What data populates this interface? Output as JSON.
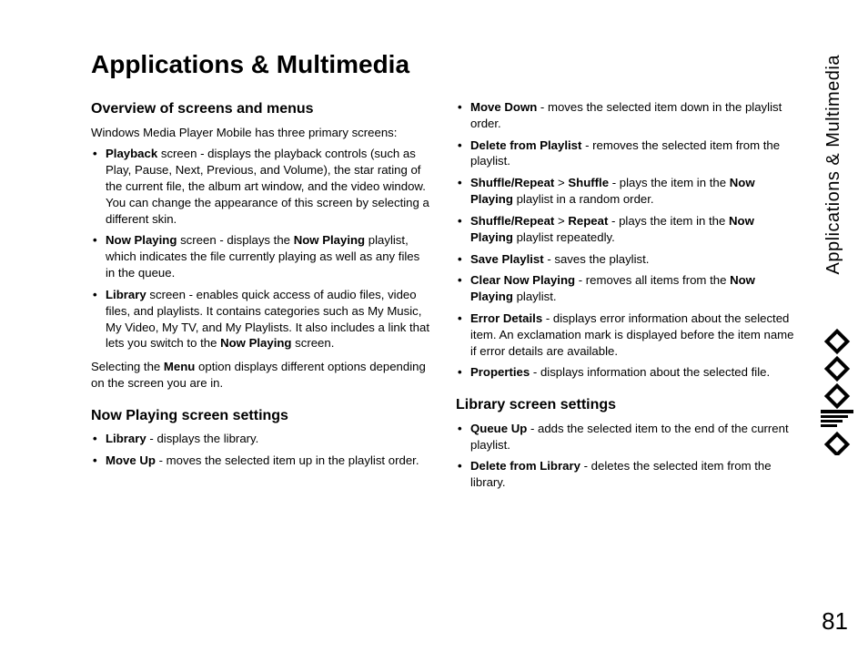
{
  "title": "Applications & Multimedia",
  "side_label": "Applications & Multimedia",
  "page_number": "81",
  "col1": {
    "h_overview": "Overview of screens and menus",
    "p_intro": "Windows Media Player Mobile has three primary screens:",
    "b_playback_label": "Playback",
    "b_playback_text": " screen - displays the playback controls (such as Play, Pause, Next, Previous, and Volume), the star rating of the current file, the album art window, and the video window. You can change the appearance of this screen by selecting a different skin.",
    "b_nowplaying_label": "Now Playing",
    "b_nowplaying_text1": " screen - displays the ",
    "b_nowplaying_bold": "Now Playing",
    "b_nowplaying_text2": " playlist, which indicates the file currently playing as well as any files in the queue.",
    "b_library_label": "Library",
    "b_library_text1": " screen - enables quick access of audio files, video files, and playlists. It contains categories such as My Music, My Video, My TV, and My Playlists. It also includes a link that lets you switch to the ",
    "b_library_bold": "Now Playing",
    "b_library_text2": " screen.",
    "p_menu_1": "Selecting the ",
    "p_menu_bold": "Menu",
    "p_menu_2": " option displays different options depending on the screen you are in.",
    "h_nowplaying": "Now Playing screen settings",
    "np_library_label": "Library",
    "np_library_text": " - displays the library.",
    "np_moveup_label": "Move Up",
    "np_moveup_text": " - moves the selected item up in the playlist order."
  },
  "col2": {
    "np_movedown_label": "Move Down",
    "np_movedown_text": " - moves the selected item down in the playlist order.",
    "np_delete_label": "Delete from Playlist",
    "np_delete_text": " - removes the selected item from the playlist.",
    "np_shuffle_l1": "Shuffle/Repeat",
    "np_shuffle_gt": " > ",
    "np_shuffle_l2": "Shuffle",
    "np_shuffle_text1": " - plays the item in the ",
    "np_shuffle_bold": "Now Playing",
    "np_shuffle_text2": " playlist in a random order.",
    "np_repeat_l1": "Shuffle/Repeat",
    "np_repeat_gt": " > ",
    "np_repeat_l2": "Repeat",
    "np_repeat_text1": " - plays the item in the ",
    "np_repeat_bold": "Now Playing",
    "np_repeat_text2": " playlist repeatedly.",
    "np_save_label": "Save Playlist",
    "np_save_text": " - saves the playlist.",
    "np_clear_label": "Clear Now Playing",
    "np_clear_text1": " - removes all items from the ",
    "np_clear_bold": "Now Playing",
    "np_clear_text2": " playlist.",
    "np_error_label": "Error Details",
    "np_error_text": " - displays error information about the selected item. An exclamation mark is displayed before the item name if error details are available.",
    "np_props_label": "Properties",
    "np_props_text": " - displays information about the selected file.",
    "h_library": "Library screen settings",
    "lib_queue_label": "Queue Up",
    "lib_queue_text": " - adds the selected item to the end of the current playlist.",
    "lib_delete_label": "Delete from Library",
    "lib_delete_text": " - deletes the selected item from the library."
  }
}
